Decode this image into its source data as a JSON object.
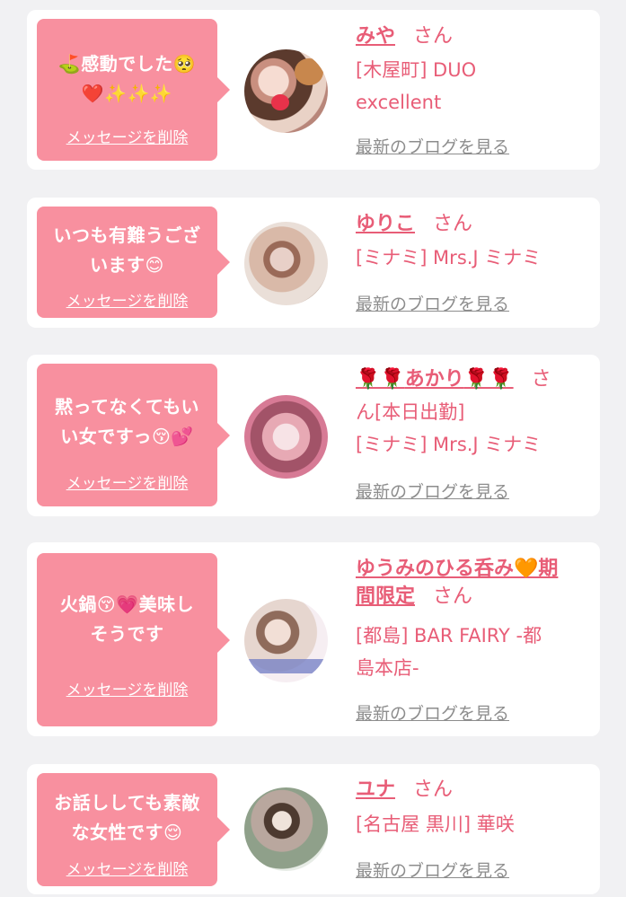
{
  "colors": {
    "page_bg": "#f1f1f3",
    "card_bg": "#ffffff",
    "bubble_bg": "#f8909f",
    "accent_pink": "#e85d77",
    "muted_gray": "#8d8d8d"
  },
  "common": {
    "delete_label": "メッセージを削除",
    "blog_label": "最新のブログを見る",
    "san": "さん"
  },
  "items": [
    {
      "message": {
        "line1": "⛳感動でした🥺",
        "line2": "❤️✨✨✨"
      },
      "name": "みや",
      "shop_line1": "[木屋町] DUO",
      "shop_line2": "excellent",
      "avatar_icon": "avatar-photo"
    },
    {
      "message": {
        "line1": "いつも有難うござ",
        "line2": "います😊"
      },
      "name": "ゆりこ",
      "shop_line1": "[ミナミ] Mrs.J ミナミ",
      "avatar_icon": "avatar-photo"
    },
    {
      "message": {
        "line1": "黙ってなくてもい",
        "line2": "い女ですっ😚💕"
      },
      "name_rose_a": "🌹🌹",
      "name": "あかり",
      "name_rose_b": "🌹🌹",
      "name_cont": "ん[本日出勤]",
      "san_first_char": "さ",
      "shop_line1": "[ミナミ] Mrs.J ミナミ",
      "avatar_icon": "avatar-photo"
    },
    {
      "message": {
        "line1": "火鍋😚💗美味し",
        "line2": "そうです"
      },
      "name_line1": "ゆうみのひる呑み🧡期",
      "name_line2": "間限定",
      "shop_line1": "[都島] BAR FAIRY -都",
      "shop_line2": "島本店-",
      "avatar_icon": "avatar-photo"
    },
    {
      "message": {
        "line1": "お話ししても素敵",
        "line2": "な女性です😌"
      },
      "name": "ユナ",
      "shop_line1": "[名古屋 黒川] 華咲",
      "avatar_icon": "avatar-photo"
    }
  ]
}
